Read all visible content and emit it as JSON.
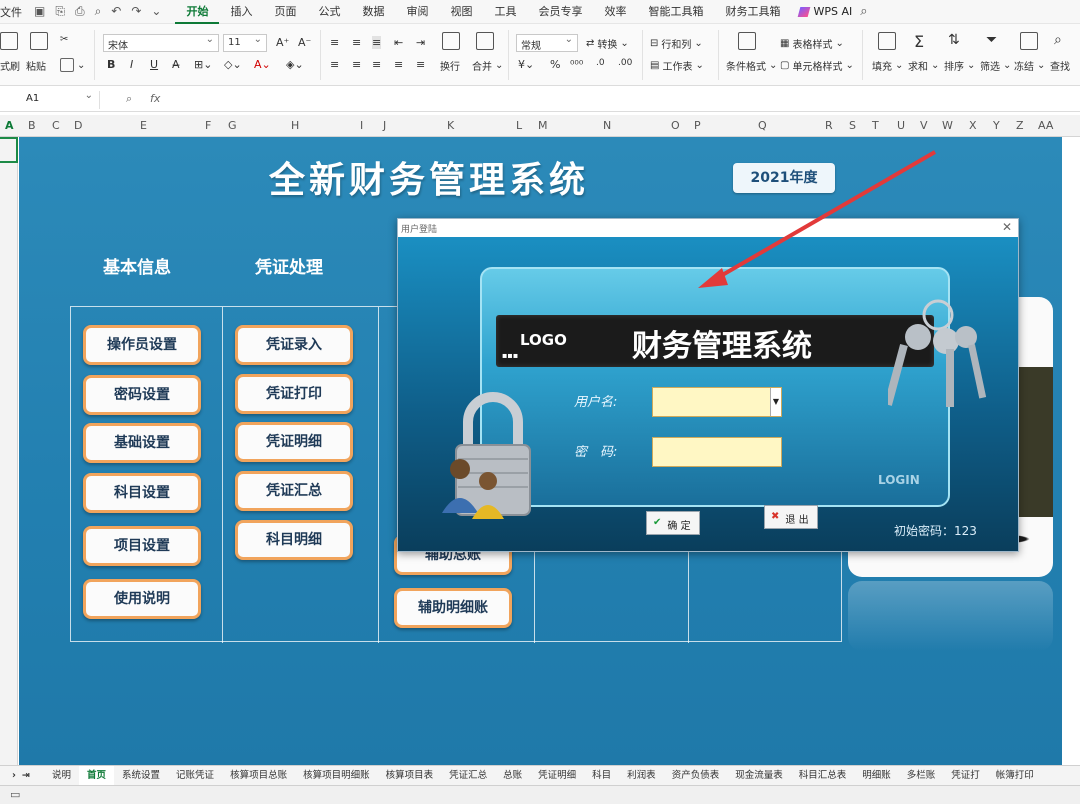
{
  "menubar": {
    "file_label": "文件",
    "tabs": [
      {
        "label": "开始",
        "active": true
      },
      {
        "label": "插入"
      },
      {
        "label": "页面"
      },
      {
        "label": "公式"
      },
      {
        "label": "数据"
      },
      {
        "label": "审阅"
      },
      {
        "label": "视图"
      },
      {
        "label": "工具"
      },
      {
        "label": "会员专享"
      },
      {
        "label": "效率"
      },
      {
        "label": "智能工具箱"
      },
      {
        "label": "财务工具箱"
      }
    ],
    "wps_ai": "WPS AI"
  },
  "ribbon": {
    "format_painter": "式刷",
    "paste": "粘贴",
    "font_name": "宋体",
    "font_size": "11",
    "wrap": "换行",
    "merge": "合并",
    "number_format": "常规",
    "convert": "转换",
    "row_col": "行和列",
    "worksheet": "工作表",
    "cond_format": "条件格式",
    "table_style": "表格样式",
    "cell_style": "单元格样式",
    "fill": "填充",
    "sum": "求和",
    "sort": "排序",
    "filter": "筛选",
    "freeze": "冻结",
    "find": "查找"
  },
  "formula_bar": {
    "cell_ref": "A1",
    "fx": "fx"
  },
  "columns": [
    "A",
    "B",
    "C",
    "D",
    "E",
    "F",
    "G",
    "H",
    "I",
    "J",
    "K",
    "L",
    "M",
    "N",
    "O",
    "P",
    "Q",
    "R",
    "S",
    "T",
    "U",
    "V",
    "W",
    "X",
    "Y",
    "Z",
    "AA"
  ],
  "sheet": {
    "title": "全新财务管理系统",
    "year": "2021年度",
    "section_basic": "基本信息",
    "section_voucher": "凭证处理",
    "basic_buttons": [
      "操作员设置",
      "密码设置",
      "基础设置",
      "科目设置",
      "项目设置",
      "使用说明"
    ],
    "voucher_buttons": [
      "凭证录入",
      "凭证打印",
      "凭证明细",
      "凭证汇总",
      "科目明细"
    ],
    "aux_buttons": [
      "辅助总账",
      "辅助明细账"
    ]
  },
  "dialog": {
    "title": "用户登陆",
    "logo": "LOGO",
    "system_name": "财务管理系统",
    "username_label": "用户名:",
    "password_label": "密　码:",
    "username_value": "",
    "password_value": "",
    "login_mark": "LOGIN",
    "ok_label": "确 定",
    "exit_label": "退 出",
    "hint": "初始密码：123"
  },
  "sheet_tabs": [
    "说明",
    "首页",
    "系统设置",
    "记账凭证",
    "核算项目总账",
    "核算项目明细账",
    "核算项目表",
    "凭证汇总",
    "总账",
    "凭证明细",
    "科目",
    "利润表",
    "资产负债表",
    "现金流量表",
    "科目汇总表",
    "明细账",
    "多栏账",
    "凭证打",
    "帐簿打印"
  ],
  "active_sheet_tab": "首页",
  "colors": {
    "accent_green": "#0e7a37",
    "canvas_blue": "#2585b6",
    "button_border": "#f1a45c"
  }
}
